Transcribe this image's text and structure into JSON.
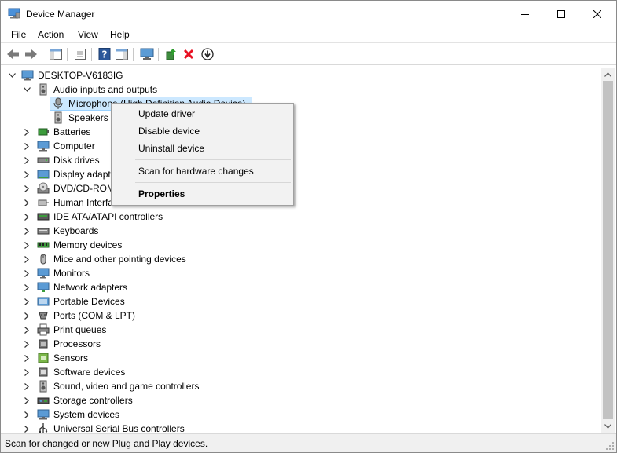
{
  "window": {
    "title": "Device Manager",
    "controls": [
      "minimize",
      "maximize",
      "close"
    ]
  },
  "menubar": {
    "items": [
      "File",
      "Action",
      "View",
      "Help"
    ]
  },
  "toolbar": {
    "buttons": [
      "back-arrow-icon",
      "forward-arrow-icon",
      "show-hide-console-tree-icon",
      "properties-sheet-icon",
      "help-icon",
      "action-pane-icon",
      "scan-monitor-icon",
      "update-driver-icon",
      "uninstall-x-icon",
      "disable-device-icon"
    ]
  },
  "tree": {
    "root": "DESKTOP-V6183IG",
    "expanded_category": "Audio inputs and outputs",
    "audio_children": [
      "Microphone (High Definition Audio Device)",
      "Speakers (High Definition Audio Device)"
    ],
    "visible_audio_children": [
      "Microphone (High Definition Audio Device)",
      "Speakers ("
    ],
    "categories": [
      "Batteries",
      "Computer",
      "Disk drives",
      "Display adapters",
      "DVD/CD-ROM drives",
      "Human Interface Devices",
      "IDE ATA/ATAPI controllers",
      "Keyboards",
      "Memory devices",
      "Mice and other pointing devices",
      "Monitors",
      "Network adapters",
      "Portable Devices",
      "Ports (COM & LPT)",
      "Print queues",
      "Processors",
      "Sensors",
      "Software devices",
      "Sound, video and game controllers",
      "Storage controllers",
      "System devices",
      "Universal Serial Bus controllers"
    ]
  },
  "context_menu": {
    "items": [
      "Update driver",
      "Disable device",
      "Uninstall device",
      "Scan for hardware changes",
      "Properties"
    ]
  },
  "status": {
    "text": "Scan for changed or new Plug and Play devices."
  },
  "colors": {
    "selection": "#cce8ff",
    "selection_border": "#99d1ff",
    "menu_bg": "#f2f2f2",
    "uninstall_red": "#e81123",
    "help_blue": "#2b579a"
  }
}
